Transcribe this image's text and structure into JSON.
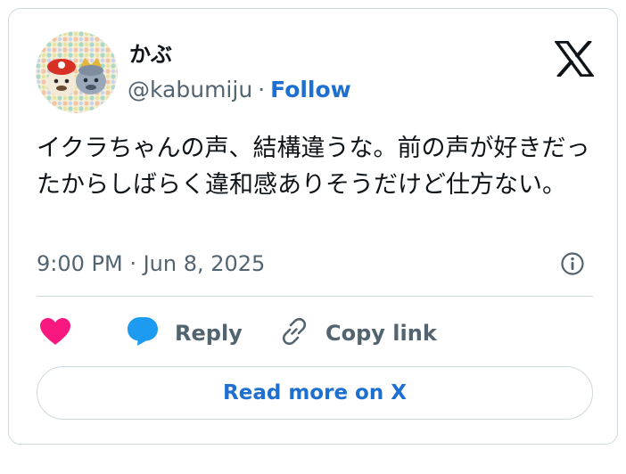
{
  "user": {
    "display_name": "かぶ",
    "handle": "@kabumiju",
    "separator": "·",
    "follow_label": "Follow"
  },
  "tweet": {
    "text": "イクラちゃんの声、結構違うな。前の声が好きだったからしばらく違和感ありそうだけど仕方ない。",
    "timestamp": "9:00 PM · Jun 8, 2025"
  },
  "actions": {
    "reply_label": "Reply",
    "copy_link_label": "Copy link"
  },
  "read_more_label": "Read more on X",
  "colors": {
    "link": "#1d6fd0",
    "like": "#f91880",
    "reply": "#1d9bf0",
    "secondary_text": "#536471",
    "border": "#cfd9de"
  },
  "icons": [
    "x-logo-icon",
    "info-icon",
    "heart-icon",
    "reply-bubble-icon",
    "link-icon"
  ]
}
